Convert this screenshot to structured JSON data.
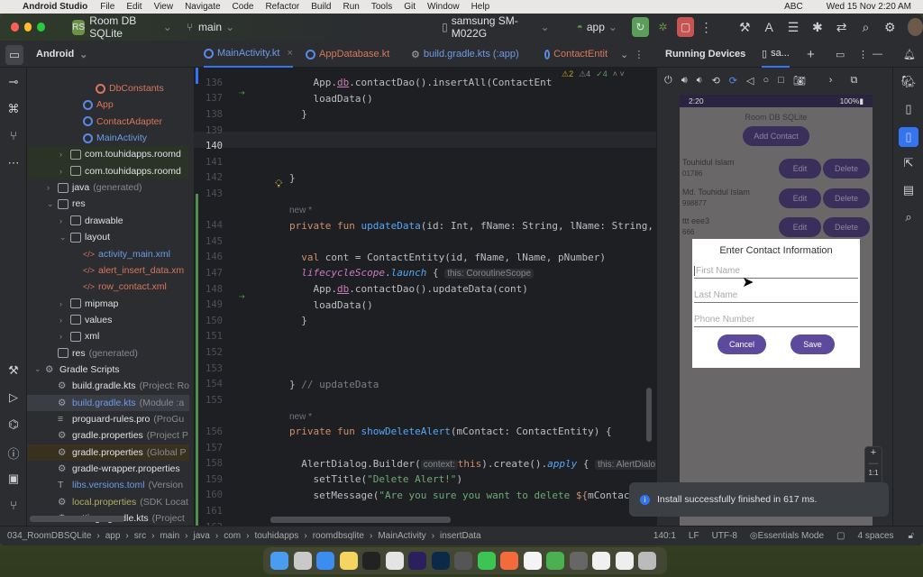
{
  "menubar": {
    "app": "Android Studio",
    "items": [
      "File",
      "Edit",
      "View",
      "Navigate",
      "Code",
      "Refactor",
      "Build",
      "Run",
      "Tools",
      "Git",
      "Window",
      "Help"
    ],
    "clock": "Wed 15 Nov  2:20 AM",
    "input": "ABC"
  },
  "titlebar": {
    "project_badge": "RS",
    "project": "Room DB SQLite",
    "branch": "main",
    "device": "samsung SM-M022G",
    "run_config": "app"
  },
  "toolrow": {
    "view": "Android",
    "tabs": [
      "MainActivity.kt",
      "AppDatabase.kt",
      "build.gradle.kts (:app)",
      "ContactEntit"
    ],
    "running_devices": "Running Devices",
    "device_tab": "sa..."
  },
  "tree": [
    {
      "label": "DbConstants",
      "ind": 4,
      "type": "kt",
      "color": "#d9775c"
    },
    {
      "label": "App",
      "ind": 3,
      "type": "kt",
      "color": "#d9775c"
    },
    {
      "label": "ContactAdapter",
      "ind": 3,
      "type": "kt",
      "color": "#d9775c"
    },
    {
      "label": "MainActivity",
      "ind": 3,
      "type": "kt",
      "color": "#6f9be8"
    },
    {
      "label": "com.touhidapps.roomd",
      "ind": 2,
      "type": "folder",
      "arrow": ">",
      "color": "#dfe1e5"
    },
    {
      "label": "com.touhidapps.roomd",
      "ind": 2,
      "type": "folder",
      "arrow": ">",
      "color": "#dfe1e5"
    },
    {
      "label": "java",
      "extra": "(generated)",
      "ind": 1,
      "type": "folder",
      "arrow": ">",
      "color": "#dfe1e5"
    },
    {
      "label": "res",
      "ind": 1,
      "type": "folder",
      "arrow": "v",
      "color": "#dfe1e5"
    },
    {
      "label": "drawable",
      "ind": 2,
      "type": "folder",
      "arrow": ">",
      "color": "#dfe1e5"
    },
    {
      "label": "layout",
      "ind": 2,
      "type": "folder",
      "arrow": "v",
      "color": "#dfe1e5"
    },
    {
      "label": "activity_main.xml",
      "ind": 3,
      "type": "xml",
      "color": "#6f9be8"
    },
    {
      "label": "alert_insert_data.xm",
      "ind": 3,
      "type": "xml",
      "color": "#d9775c"
    },
    {
      "label": "row_contact.xml",
      "ind": 3,
      "type": "xml",
      "color": "#d9775c"
    },
    {
      "label": "mipmap",
      "ind": 2,
      "type": "folder",
      "arrow": ">",
      "color": "#dfe1e5"
    },
    {
      "label": "values",
      "ind": 2,
      "type": "folder",
      "arrow": ">",
      "color": "#dfe1e5"
    },
    {
      "label": "xml",
      "ind": 2,
      "type": "folder",
      "arrow": ">",
      "color": "#dfe1e5"
    },
    {
      "label": "res",
      "extra": "(generated)",
      "ind": 1,
      "type": "folder",
      "color": "#dfe1e5"
    },
    {
      "label": "Gradle Scripts",
      "ind": 0,
      "type": "gradle",
      "arrow": "v",
      "color": "#dfe1e5"
    },
    {
      "label": "build.gradle.kts",
      "extra": "(Project: Ro",
      "ind": 1,
      "type": "gradle",
      "color": "#dfe1e5"
    },
    {
      "label": "build.gradle.kts",
      "extra": "(Module :a",
      "ind": 1,
      "type": "gradle",
      "color": "#6f9be8"
    },
    {
      "label": "proguard-rules.pro",
      "extra": "(ProGu",
      "ind": 1,
      "type": "text",
      "color": "#dfe1e5"
    },
    {
      "label": "gradle.properties",
      "extra": "(Project P",
      "ind": 1,
      "type": "gear",
      "color": "#dfe1e5"
    },
    {
      "label": "gradle.properties",
      "extra": "(Global P",
      "ind": 1,
      "type": "gear",
      "color": "#dfe1e5"
    },
    {
      "label": "gradle-wrapper.properties",
      "ind": 1,
      "type": "gear",
      "color": "#dfe1e5"
    },
    {
      "label": "libs.versions.toml",
      "extra": "(Version",
      "ind": 1,
      "type": "toml",
      "color": "#6f9be8"
    },
    {
      "label": "local.properties",
      "extra": "(SDK Locat",
      "ind": 1,
      "type": "gear",
      "color": "#b3ae60"
    },
    {
      "label": "settings.gradle.kts",
      "extra": "(Project",
      "ind": 1,
      "type": "gradle",
      "color": "#dfe1e5"
    }
  ],
  "editor": {
    "inspections": {
      "warnings_a": "2",
      "warnings_b": "4",
      "ok": "4"
    },
    "lines": [
      {
        "n": "136",
        "t": [
          [
            "    App.",
            ""
          ],
          [
            "db",
            "prop"
          ],
          [
            ".contactDao().insertAll(ContactEnt",
            ""
          ]
        ]
      },
      {
        "n": "137",
        "t": [
          [
            "    loadData()",
            ""
          ]
        ]
      },
      {
        "n": "138",
        "t": [
          [
            "  }",
            ""
          ]
        ]
      },
      {
        "n": "139",
        "t": []
      },
      {
        "n": "140",
        "t": []
      },
      {
        "n": "141",
        "t": []
      },
      {
        "n": "142",
        "t": [
          [
            "}",
            ""
          ]
        ]
      },
      {
        "n": "143",
        "t": []
      },
      {
        "n": "",
        "t": [
          [
            "new *",
            "newlbl"
          ]
        ]
      },
      {
        "n": "144",
        "t": [
          [
            "private fun ",
            "kw"
          ],
          [
            "updateData",
            "fn"
          ],
          [
            "(id: Int, fName: String, lName: String, pNu",
            ""
          ]
        ]
      },
      {
        "n": "145",
        "t": []
      },
      {
        "n": "146",
        "t": [
          [
            "  ",
            ""
          ],
          [
            "val ",
            "kw"
          ],
          [
            "cont = ContactEntity(id, fName, lName, pNumber)",
            ""
          ]
        ]
      },
      {
        "n": "147",
        "t": [
          [
            "  ",
            ""
          ],
          [
            "lifecycleScope",
            "pr"
          ],
          [
            ".",
            ""
          ],
          [
            "launch",
            "it"
          ],
          [
            " { ",
            ""
          ],
          [
            "this: CoroutineScope",
            "hint"
          ]
        ]
      },
      {
        "n": "148",
        "t": [
          [
            "    App.",
            ""
          ],
          [
            "db",
            "prop"
          ],
          [
            ".contactDao().updateData(cont)",
            ""
          ]
        ]
      },
      {
        "n": "149",
        "t": [
          [
            "    loadData()",
            ""
          ]
        ]
      },
      {
        "n": "150",
        "t": [
          [
            "  }",
            ""
          ]
        ]
      },
      {
        "n": "151",
        "t": []
      },
      {
        "n": "152",
        "t": []
      },
      {
        "n": "153",
        "t": []
      },
      {
        "n": "154",
        "t": [
          [
            "} ",
            ""
          ],
          [
            "// updateData",
            "cm"
          ]
        ]
      },
      {
        "n": "155",
        "t": []
      },
      {
        "n": "",
        "t": [
          [
            "new *",
            "newlbl"
          ]
        ]
      },
      {
        "n": "156",
        "t": [
          [
            "private fun ",
            "kw"
          ],
          [
            "showDeleteAlert",
            "fn"
          ],
          [
            "(mContact: ContactEntity) {",
            ""
          ]
        ]
      },
      {
        "n": "157",
        "t": []
      },
      {
        "n": "158",
        "t": [
          [
            "  AlertDialog.Builder(",
            ""
          ],
          [
            "context:",
            "hint"
          ],
          [
            "this",
            "kw"
          ],
          [
            ").create().",
            ""
          ],
          [
            "apply",
            "it"
          ],
          [
            " { ",
            ""
          ],
          [
            "this: AlertDialo",
            "hint"
          ]
        ]
      },
      {
        "n": "159",
        "t": [
          [
            "    setTitle(",
            ""
          ],
          [
            "\"Delete Alert!\"",
            "str"
          ],
          [
            ")",
            ""
          ]
        ]
      },
      {
        "n": "160",
        "t": [
          [
            "    setMessage(",
            ""
          ],
          [
            "\"Are you sure you want to delete ",
            "str"
          ],
          [
            "${",
            "kw"
          ],
          [
            "mContac",
            ""
          ]
        ]
      },
      {
        "n": "161",
        "t": []
      },
      {
        "n": "162",
        "t": []
      }
    ]
  },
  "phone": {
    "time": "2:20",
    "battery": "100%",
    "app_title": "Room DB SQLite",
    "add_button": "Add Contact",
    "contacts": [
      {
        "name": "Touhidul Islam",
        "phone": "01786"
      },
      {
        "name": "Md. Touhidul Islam",
        "phone": "998877"
      },
      {
        "name": "ttt eee3",
        "phone": "666"
      }
    ],
    "edit": "Edit",
    "delete": "Delete",
    "dialog": {
      "title": "Enter Contact Information",
      "first_name": "First Name",
      "last_name": "Last Name",
      "phone": "Phone Number",
      "cancel": "Cancel",
      "save": "Save"
    },
    "zoom_reset": "1:1"
  },
  "toast": "Install successfully finished in 617 ms.",
  "statusbar": {
    "breadcrumbs": [
      "034_RoomDBSQLite",
      "app",
      "src",
      "main",
      "java",
      "com",
      "touhidapps",
      "roomdbsqlite",
      "MainActivity",
      "insertData"
    ],
    "position": "140:1",
    "line_sep": "LF",
    "encoding": "UTF-8",
    "mode": "Essentials Mode",
    "indent": "4 spaces"
  },
  "dock_colors": [
    "#4a9cf0",
    "#c9c9c9",
    "#3c8df0",
    "#f5d560",
    "#222",
    "#e4e4e4",
    "#2b1f5c",
    "#0b2a4a",
    "#555",
    "#3cc553",
    "#f36b3a",
    "#f4f4f4",
    "#4caf50",
    "#666",
    "#f0f0f0",
    "#eee",
    "#bbb"
  ]
}
